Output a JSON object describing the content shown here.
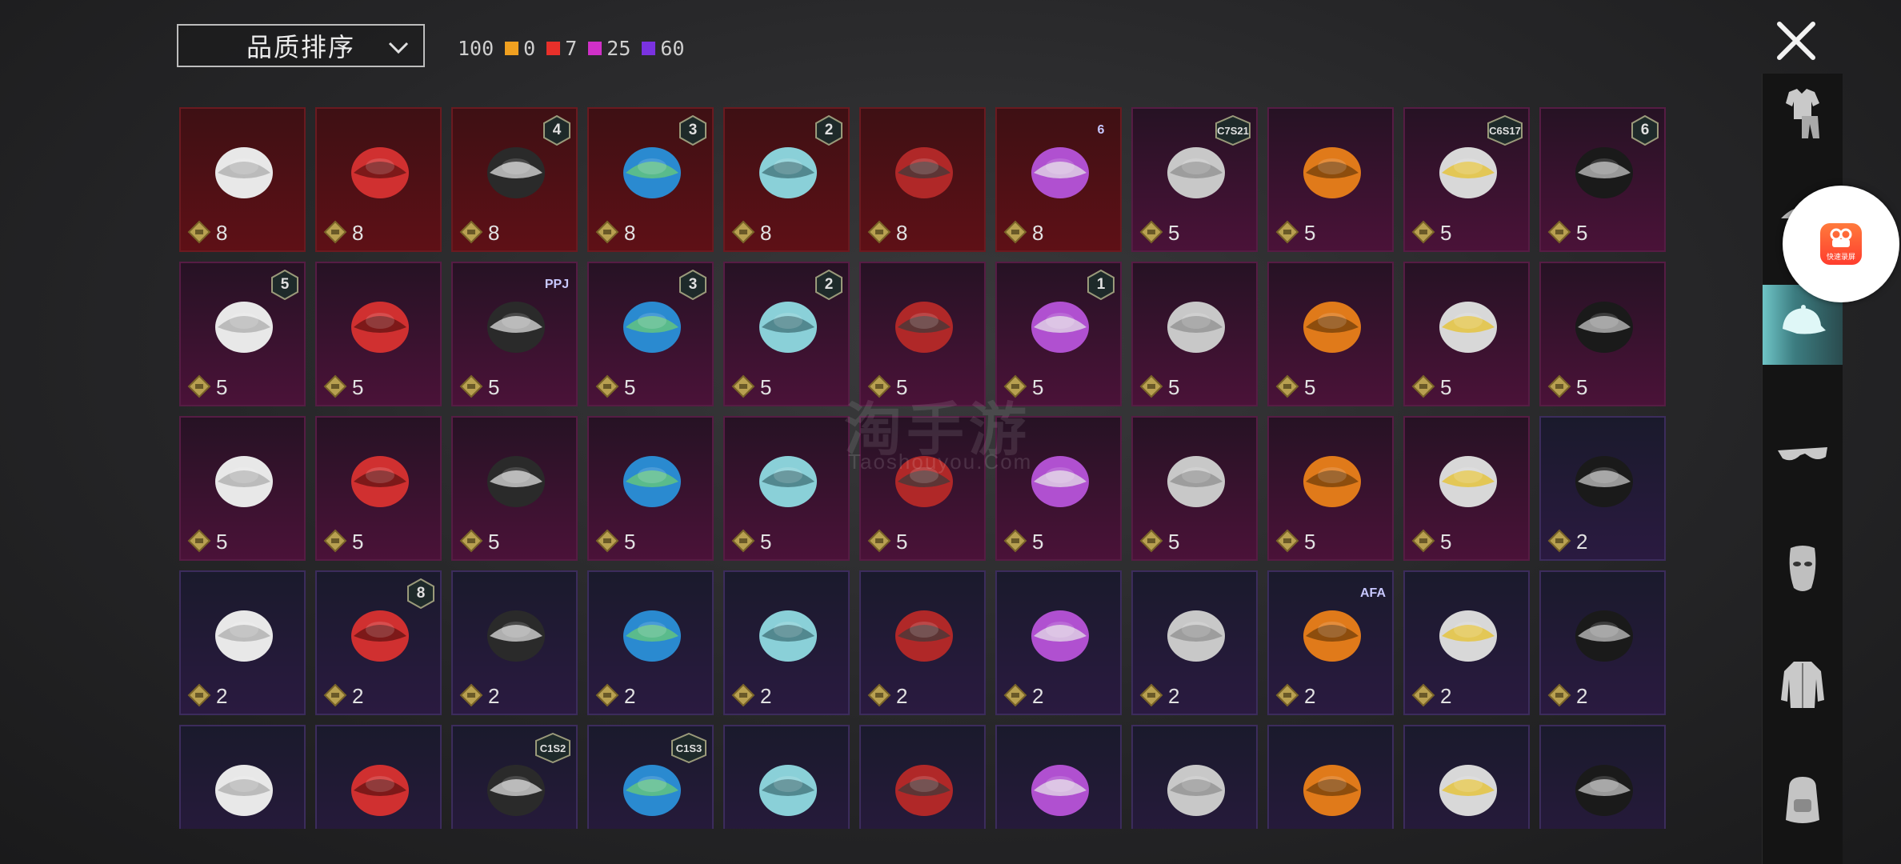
{
  "sort": {
    "label": "品质排序"
  },
  "counts": [
    {
      "value": "100",
      "color": ""
    },
    {
      "value": "0",
      "color": "#f0a020"
    },
    {
      "value": "7",
      "color": "#e8302a"
    },
    {
      "value": "25",
      "color": "#d030c8"
    },
    {
      "value": "60",
      "color": "#7a32e0"
    }
  ],
  "watermark": {
    "main": "淘手游",
    "sub": "Taoshouyou.Com"
  },
  "float_button": {
    "label": "快速录屏"
  },
  "sidebar": {
    "items": [
      {
        "icon": "outfit-icon"
      },
      {
        "icon": "headwear-icon",
        "active": true
      },
      {
        "icon": "eyewear-icon"
      },
      {
        "icon": "mask-icon"
      },
      {
        "icon": "jacket-icon"
      },
      {
        "icon": "backpack-icon"
      }
    ]
  },
  "items": [
    {
      "name": "white-cowboy-hat",
      "tier": "red",
      "value": "8",
      "badge": ""
    },
    {
      "name": "red-helmet",
      "tier": "red",
      "value": "8",
      "badge": ""
    },
    {
      "name": "snowman-top-hat",
      "tier": "red",
      "value": "8",
      "badge": "4"
    },
    {
      "name": "blue-afro-wig",
      "tier": "red",
      "value": "8",
      "badge": "3"
    },
    {
      "name": "teal-bucket-hat",
      "tier": "red",
      "value": "8",
      "badge": "2"
    },
    {
      "name": "red-mech-helmet",
      "tier": "red",
      "value": "8",
      "badge": ""
    },
    {
      "name": "purple-robot-head",
      "tier": "red",
      "value": "8",
      "badge": "6",
      "badge_type": "plain"
    },
    {
      "name": "silver-hair",
      "tier": "purple",
      "value": "5",
      "badge": "C7S21",
      "badge_type": "wide"
    },
    {
      "name": "pumpkin-head",
      "tier": "purple",
      "value": "5",
      "badge": ""
    },
    {
      "name": "yellow-visor-hair",
      "tier": "purple",
      "value": "5",
      "badge": "C6S17",
      "badge_type": "wide"
    },
    {
      "name": "black-horned-helmet",
      "tier": "purple",
      "value": "5",
      "badge": "6"
    },
    {
      "name": "bow-pigtails",
      "tier": "purple",
      "value": "5",
      "badge": "5"
    },
    {
      "name": "blonde-braids",
      "tier": "purple",
      "value": "5",
      "badge": ""
    },
    {
      "name": "pink-cat-mask",
      "tier": "purple",
      "value": "5",
      "badge": "PPJ",
      "badge_type": "plain"
    },
    {
      "name": "jester-hat",
      "tier": "purple",
      "value": "5",
      "badge": "3"
    },
    {
      "name": "blonde-dreadlocks",
      "tier": "purple",
      "value": "5",
      "badge": "2"
    },
    {
      "name": "orange-fish-mask",
      "tier": "purple",
      "value": "5",
      "badge": ""
    },
    {
      "name": "silver-twin-tails",
      "tier": "purple",
      "value": "5",
      "badge": "1"
    },
    {
      "name": "green-knight-helmet",
      "tier": "purple",
      "value": "5",
      "badge": ""
    },
    {
      "name": "blue-gold-mask",
      "tier": "purple",
      "value": "5",
      "badge": ""
    },
    {
      "name": "black-visor-helmet",
      "tier": "purple",
      "value": "5",
      "badge": ""
    },
    {
      "name": "golden-totem-helmet",
      "tier": "purple",
      "value": "5",
      "badge": ""
    },
    {
      "name": "kendo-helmet",
      "tier": "purple",
      "value": "5",
      "badge": ""
    },
    {
      "name": "yellow-pith-helmet",
      "tier": "purple",
      "value": "5",
      "badge": ""
    },
    {
      "name": "black-cat-mask",
      "tier": "purple",
      "value": "5",
      "badge": ""
    },
    {
      "name": "skull-dreadlocks",
      "tier": "purple",
      "value": "5",
      "badge": ""
    },
    {
      "name": "zebra-mask",
      "tier": "purple",
      "value": "5",
      "badge": ""
    },
    {
      "name": "green-frog-pilot",
      "tier": "purple",
      "value": "5",
      "badge": ""
    },
    {
      "name": "green-frog-cap",
      "tier": "purple",
      "value": "5",
      "badge": ""
    },
    {
      "name": "luchador-mask",
      "tier": "purple",
      "value": "5",
      "badge": ""
    },
    {
      "name": "black-headband",
      "tier": "purple",
      "value": "5",
      "badge": ""
    },
    {
      "name": "skull-balaclava",
      "tier": "purple",
      "value": "5",
      "badge": ""
    },
    {
      "name": "grey-hair",
      "tier": "blue",
      "value": "2",
      "badge": ""
    },
    {
      "name": "masked-beanie",
      "tier": "blue",
      "value": "2",
      "badge": ""
    },
    {
      "name": "green-skull-hood",
      "tier": "blue",
      "value": "2",
      "badge": "8"
    },
    {
      "name": "white-cap",
      "tier": "blue",
      "value": "2",
      "badge": ""
    },
    {
      "name": "gas-mask-helmet",
      "tier": "blue",
      "value": "2",
      "badge": ""
    },
    {
      "name": "gold-visor-helmet",
      "tier": "blue",
      "value": "2",
      "badge": ""
    },
    {
      "name": "aviator-cap",
      "tier": "blue",
      "value": "2",
      "badge": ""
    },
    {
      "name": "dotted-cap",
      "tier": "blue",
      "value": "2",
      "badge": ""
    },
    {
      "name": "hooded-headgear",
      "tier": "blue",
      "value": "2",
      "badge": ""
    },
    {
      "name": "light-blue-cap",
      "tier": "blue",
      "value": "2",
      "badge": "AFA",
      "badge_type": "plain"
    },
    {
      "name": "red-bow-pigtails",
      "tier": "blue",
      "value": "2",
      "badge": ""
    },
    {
      "name": "red-devil-horns",
      "tier": "blue",
      "value": "2",
      "badge": ""
    },
    {
      "name": "dark-beanie",
      "tier": "blue",
      "value": "",
      "badge": ""
    },
    {
      "name": "bucket-hat-hood",
      "tier": "blue",
      "value": "",
      "badge": ""
    },
    {
      "name": "pink-bandana",
      "tier": "blue",
      "value": "",
      "badge": "C1S2",
      "badge_type": "wide"
    },
    {
      "name": "gold-gauntlet",
      "tier": "blue",
      "value": "",
      "badge": "C1S3",
      "badge_type": "wide"
    },
    {
      "name": "cricket-helmet",
      "tier": "blue",
      "value": "",
      "badge": ""
    },
    {
      "name": "sombrero",
      "tier": "blue",
      "value": "",
      "badge": ""
    },
    {
      "name": "bowler-hat",
      "tier": "blue",
      "value": "",
      "badge": ""
    },
    {
      "name": "samurai-helmet",
      "tier": "blue",
      "value": "",
      "badge": ""
    },
    {
      "name": "brown-hair",
      "tier": "blue",
      "value": "",
      "badge": ""
    },
    {
      "name": "purple-witch-hat",
      "tier": "blue",
      "value": "",
      "badge": ""
    },
    {
      "name": "navy-cap",
      "tier": "blue",
      "value": "",
      "badge": ""
    }
  ]
}
